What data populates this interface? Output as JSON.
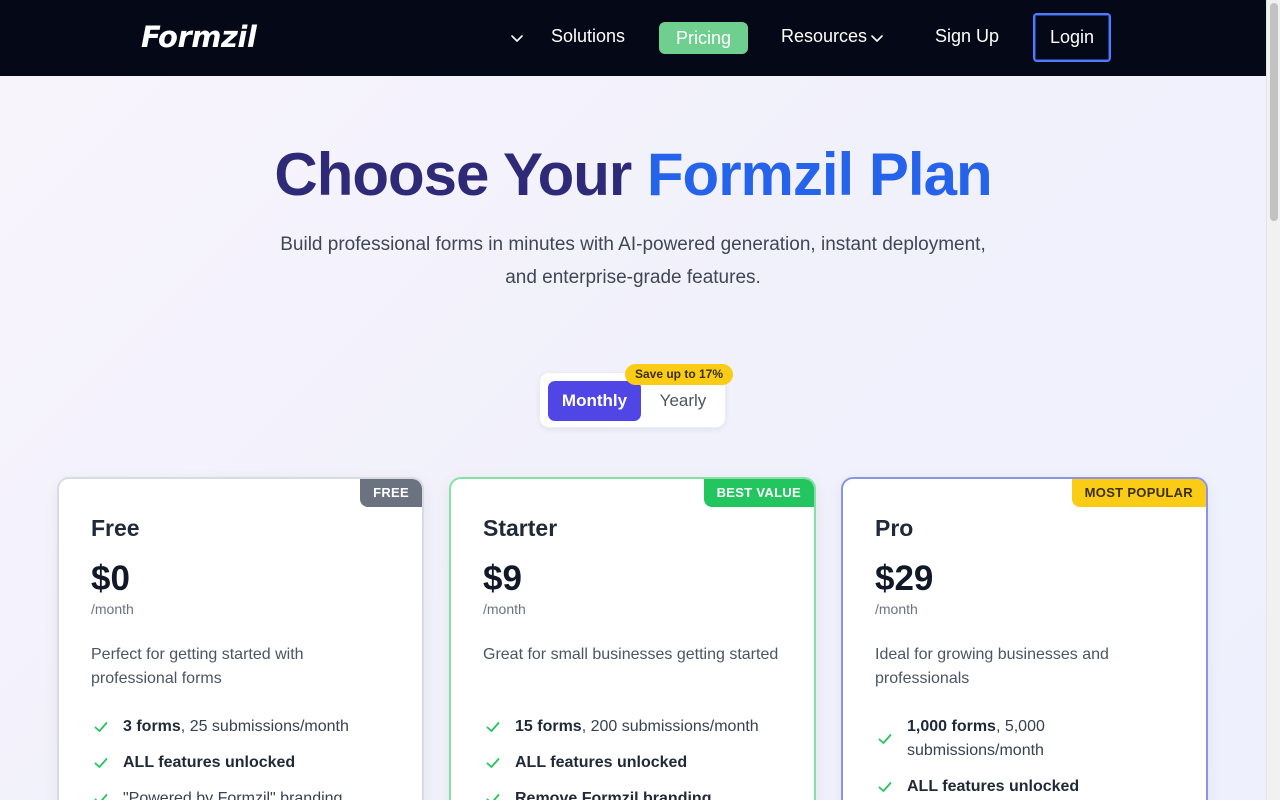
{
  "nav": {
    "logo": "Formzil",
    "items": {
      "solutions": "Solutions",
      "pricing": "Pricing",
      "resources": "Resources",
      "signup": "Sign Up",
      "login": "Login"
    }
  },
  "hero": {
    "title_part1": "Choose Your ",
    "title_accent": "Formzil Plan",
    "subtitle_line1": "Build professional forms in minutes with AI-powered generation, instant deployment,",
    "subtitle_line2": "and enterprise-grade features."
  },
  "billing_toggle": {
    "monthly": "Monthly",
    "yearly": "Yearly",
    "selected": "Monthly",
    "save_badge": "Save up to 17%"
  },
  "plans": [
    {
      "ribbon": "FREE",
      "name": "Free",
      "price": "$0",
      "period": "/month",
      "description": "Perfect for getting started with professional forms",
      "features": [
        {
          "bold": "3 forms",
          "rest": ", 25 submissions/month"
        },
        {
          "bold": "ALL features unlocked",
          "rest": ""
        },
        {
          "bold": "",
          "rest": "\"Powered by Formzil\" branding"
        }
      ]
    },
    {
      "ribbon": "BEST VALUE",
      "name": "Starter",
      "price": "$9",
      "period": "/month",
      "description": "Great for small businesses getting started",
      "features": [
        {
          "bold": "15 forms",
          "rest": ", 200 submissions/month"
        },
        {
          "bold": "ALL features unlocked",
          "rest": ""
        },
        {
          "bold": "Remove Formzil branding",
          "rest": ""
        }
      ]
    },
    {
      "ribbon": "MOST POPULAR",
      "name": "Pro",
      "price": "$29",
      "period": "/month",
      "description": "Ideal for growing businesses and professionals",
      "features": [
        {
          "bold": "1,000 forms",
          "rest": ", 5,000 submissions/month"
        },
        {
          "bold": "ALL features unlocked",
          "rest": ""
        }
      ]
    }
  ],
  "colors": {
    "nav_bg": "#050816",
    "pricing_active": "#6fcf8f",
    "title_dark": "#2e2a78",
    "title_accent": "#2563eb",
    "toggle_active": "#4f46e5",
    "badge_yellow": "#facc15",
    "check_green": "#22c55e"
  },
  "icons": {
    "nav_dropdown": "chevron-down-icon",
    "feature_check": "check-icon"
  }
}
